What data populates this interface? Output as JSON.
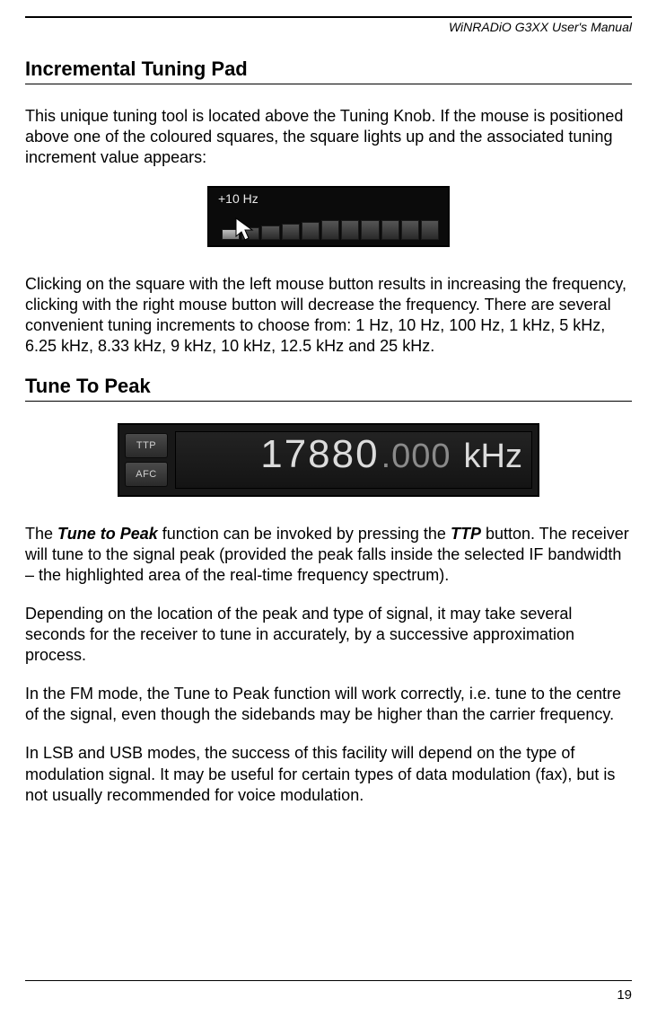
{
  "header": {
    "doc_title": "WiNRADiO G3XX User's Manual"
  },
  "section1": {
    "heading": "Incremental Tuning Pad",
    "para1": "This unique tuning tool is located above the Tuning Knob. If the mouse is positioned above one of the coloured squares, the square lights up and the associated tuning increment value appears:",
    "fig_label": "+10 Hz",
    "para2": "Clicking on the square with the left mouse button results in increasing the frequency, clicking with the right mouse button will decrease the frequency. There are several convenient tuning increments to choose from: 1 Hz, 10 Hz, 100 Hz, 1 kHz, 5 kHz, 6.25 kHz, 8.33 kHz, 9 kHz, 10 kHz, 12.5 kHz and 25 kHz."
  },
  "section2": {
    "heading": "Tune To Peak",
    "fig": {
      "btn_ttp": "TTP",
      "btn_afc": "AFC",
      "freq_main": "17880",
      "freq_frac": ".000",
      "freq_unit": "kHz"
    },
    "para1_a": "The ",
    "para1_b": "Tune to Peak",
    "para1_c": " function can be invoked by pressing the ",
    "para1_d": "TTP",
    "para1_e": " button. The receiver will tune to the signal peak (provided the peak falls inside the selected IF bandwidth – the highlighted area of the real-time frequency spectrum).",
    "para2": "Depending on the location of the peak and type of signal, it may take several seconds for the receiver to tune in accurately, by a successive approximation process.",
    "para3": "In the FM mode, the Tune to Peak function will work correctly, i.e. tune to the centre of the signal, even though the sidebands may be higher than the carrier frequency.",
    "para4": "In LSB and USB modes, the success of this facility will depend on the type of modulation signal. It may be useful for certain types of data modulation (fax), but is not usually recommended for voice modulation."
  },
  "footer": {
    "page_number": "19"
  }
}
